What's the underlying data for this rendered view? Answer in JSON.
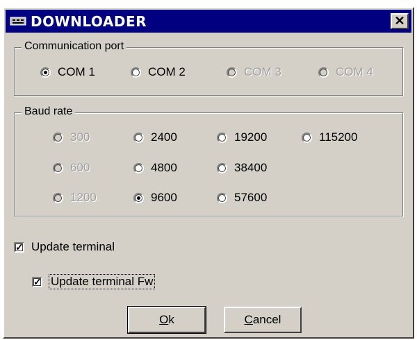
{
  "window": {
    "title": "DOWNLOADER",
    "close_glyph": "✕"
  },
  "comm_port": {
    "label": "Communication port",
    "options": [
      {
        "label": "COM 1",
        "checked": true,
        "disabled": false
      },
      {
        "label": "COM 2",
        "checked": false,
        "disabled": false
      },
      {
        "label": "COM 3",
        "checked": false,
        "disabled": true
      },
      {
        "label": "COM 4",
        "checked": false,
        "disabled": true
      }
    ]
  },
  "baud_rate": {
    "label": "Baud rate",
    "options": [
      {
        "label": "300",
        "checked": false,
        "disabled": true
      },
      {
        "label": "600",
        "checked": false,
        "disabled": true
      },
      {
        "label": "1200",
        "checked": false,
        "disabled": true
      },
      {
        "label": "2400",
        "checked": false,
        "disabled": false
      },
      {
        "label": "4800",
        "checked": false,
        "disabled": false
      },
      {
        "label": "9600",
        "checked": true,
        "disabled": false
      },
      {
        "label": "19200",
        "checked": false,
        "disabled": false
      },
      {
        "label": "38400",
        "checked": false,
        "disabled": false
      },
      {
        "label": "57600",
        "checked": false,
        "disabled": false
      },
      {
        "label": "115200",
        "checked": false,
        "disabled": false
      }
    ]
  },
  "update_terminal": {
    "label": "Update terminal",
    "checked": true
  },
  "update_terminal_fw": {
    "label": "Update terminal Fw",
    "checked": true
  },
  "buttons": {
    "ok": {
      "mnemonic": "O",
      "rest": "k"
    },
    "cancel": {
      "mnemonic": "C",
      "rest": "ancel"
    }
  },
  "icons": {
    "title": "downloader-icon",
    "close": "close-icon",
    "check": "checkmark-icon"
  }
}
